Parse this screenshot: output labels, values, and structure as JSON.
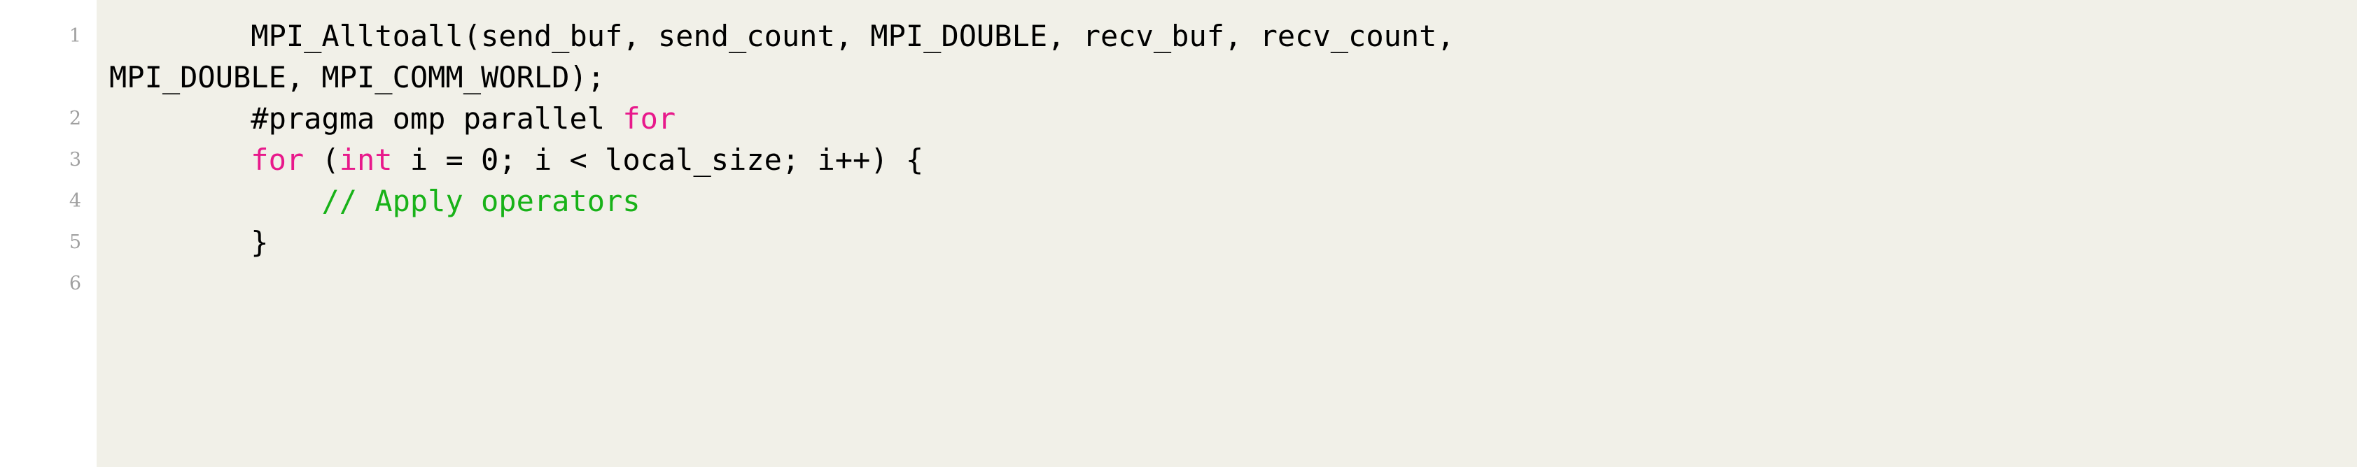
{
  "listing": {
    "background_color": "#f1f0e8",
    "page_background_color": "#ffffff",
    "line_number_color": "#a0a0a0",
    "keyword_color": "#e8198b",
    "comment_color": "#18b218",
    "text_color": "#000000",
    "line_numbers": [
      "1",
      "2",
      "3",
      "4",
      "5",
      "6"
    ],
    "lines": [
      {
        "number": "1",
        "wrapped": true,
        "segments": [
          {
            "kind": "plain",
            "text": "        MPI_Alltoall(send_buf, send_count, MPI_DOUBLE, recv_buf, recv_count,"
          }
        ],
        "continuation_segments": [
          {
            "kind": "plain",
            "text": "MPI_DOUBLE, MPI_COMM_WORLD);"
          }
        ]
      },
      {
        "number": "2",
        "wrapped": false,
        "segments": [
          {
            "kind": "plain",
            "text": "        #pragma omp parallel "
          },
          {
            "kind": "keyword",
            "text": "for"
          }
        ]
      },
      {
        "number": "3",
        "wrapped": false,
        "segments": [
          {
            "kind": "plain",
            "text": "        "
          },
          {
            "kind": "keyword",
            "text": "for"
          },
          {
            "kind": "plain",
            "text": " ("
          },
          {
            "kind": "keyword",
            "text": "int"
          },
          {
            "kind": "plain",
            "text": " i = 0; i < local_size; i++) {"
          }
        ]
      },
      {
        "number": "4",
        "wrapped": false,
        "segments": [
          {
            "kind": "plain",
            "text": "            "
          },
          {
            "kind": "comment",
            "text": "// Apply operators"
          }
        ]
      },
      {
        "number": "5",
        "wrapped": false,
        "segments": [
          {
            "kind": "plain",
            "text": "        }"
          }
        ]
      },
      {
        "number": "6",
        "wrapped": false,
        "segments": [
          {
            "kind": "plain",
            "text": ""
          }
        ]
      }
    ]
  }
}
